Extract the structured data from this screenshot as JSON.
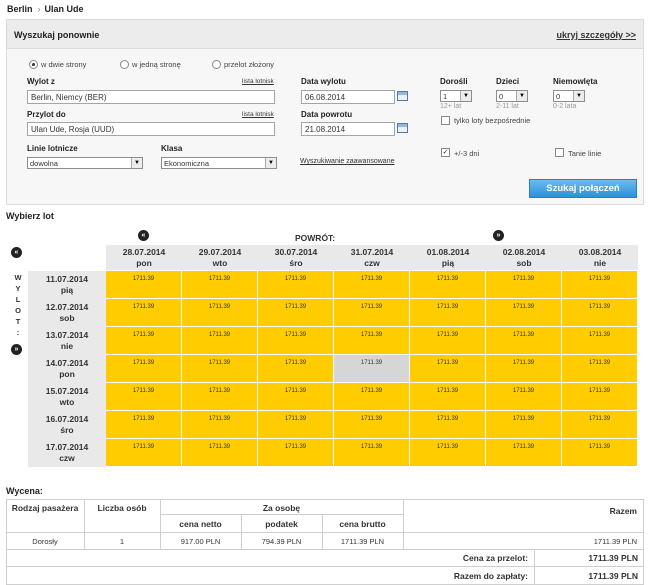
{
  "route": {
    "from": "Berlin",
    "separator": "›",
    "to": "Ulan Ude"
  },
  "search": {
    "title": "Wyszukaj ponownie",
    "hide_details": "ukryj szczegóły >>",
    "trip_types": [
      "w dwie strony",
      "w jedną stronę",
      "przelot złożony"
    ],
    "selected_trip_type": "w dwie strony",
    "from_label": "Wylot z",
    "from_value": "Berlin, Niemcy (BER)",
    "to_label": "Przylot do",
    "to_value": "Ulan Ude, Rosja (UUD)",
    "airport_list_link": "lista lotnisk",
    "depart_label": "Data wylotu",
    "depart_value": "06.08.2014",
    "return_label": "Data powrotu",
    "return_value": "21.08.2014",
    "airline_label": "Linie lotnicze",
    "airline_value": "dowolna",
    "class_label": "Klasa",
    "class_value": "Ekonomiczna",
    "advanced_link": "Wyszukiwanie zaawansowane",
    "adults_label": "Dorośli",
    "adults_value": "1",
    "adults_hint": "12+ lat",
    "children_label": "Dzieci",
    "children_value": "0",
    "children_hint": "2-11 lat",
    "infants_label": "Niemowlęta",
    "infants_value": "0",
    "infants_hint": "0-2 lata",
    "direct_only_label": "tylko loty bezpośrednie",
    "plusminus_label": "+/-3 dni",
    "cheap_lines_label": "Tanie linie",
    "search_button": "Szukaj połączeń"
  },
  "grid": {
    "title": "Wybierz lot",
    "return_label": "POWRÓT:",
    "prev_icon": "double-left-chevron",
    "next_icon": "double-right-chevron",
    "up_icon": "double-up-chevron",
    "down_icon": "double-down-chevron",
    "depart_vertical_label": "WYLOT:",
    "columns": [
      {
        "date": "28.07.2014",
        "day": "pon"
      },
      {
        "date": "29.07.2014",
        "day": "wto"
      },
      {
        "date": "30.07.2014",
        "day": "śro"
      },
      {
        "date": "31.07.2014",
        "day": "czw"
      },
      {
        "date": "01.08.2014",
        "day": "pią"
      },
      {
        "date": "02.08.2014",
        "day": "sob"
      },
      {
        "date": "03.08.2014",
        "day": "nie"
      }
    ],
    "rows": [
      {
        "date": "11.07.2014",
        "day": "pią",
        "prices": [
          "1711.39",
          "1711.39",
          "1711.39",
          "1711.39",
          "1711.39",
          "1711.39",
          "1711.39"
        ]
      },
      {
        "date": "12.07.2014",
        "day": "sob",
        "prices": [
          "1711.39",
          "1711.39",
          "1711.39",
          "1711.39",
          "1711.39",
          "1711.39",
          "1711.39"
        ]
      },
      {
        "date": "13.07.2014",
        "day": "nie",
        "prices": [
          "1711.39",
          "1711.39",
          "1711.39",
          "1711.39",
          "1711.39",
          "1711.39",
          "1711.39"
        ]
      },
      {
        "date": "14.07.2014",
        "day": "pon",
        "prices": [
          "1711.39",
          "1711.39",
          "1711.39",
          "1711.39",
          "1711.39",
          "1711.39",
          "1711.39"
        ]
      },
      {
        "date": "15.07.2014",
        "day": "wto",
        "prices": [
          "1711.39",
          "1711.39",
          "1711.39",
          "1711.39",
          "1711.39",
          "1711.39",
          "1711.39"
        ]
      },
      {
        "date": "16.07.2014",
        "day": "śro",
        "prices": [
          "1711.39",
          "1711.39",
          "1711.39",
          "1711.39",
          "1711.39",
          "1711.39",
          "1711.39"
        ]
      },
      {
        "date": "17.07.2014",
        "day": "czw",
        "prices": [
          "1711.39",
          "1711.39",
          "1711.39",
          "1711.39",
          "1711.39",
          "1711.39",
          "1711.39"
        ]
      }
    ],
    "selected": {
      "row": 3,
      "col": 3
    },
    "colors": {
      "cell": "#ffcc00",
      "selected": "#d6d6d6",
      "header": "#e9e9e9"
    }
  },
  "pricing": {
    "title": "Wycena:",
    "passenger_type_header": "Rodzaj pasażera",
    "count_header": "Liczba osób",
    "per_person_header": "Za osobę",
    "net_header": "cena netto",
    "tax_header": "podatek",
    "gross_header": "cena brutto",
    "total_header": "Razem",
    "row": {
      "type": "Dorosły",
      "count": "1",
      "net": "917.00 PLN",
      "tax": "794.39 PLN",
      "gross": "1711.39 PLN",
      "total": "1711.39 PLN"
    },
    "flight_price_label": "Cena za przelot:",
    "flight_price_value": "1711.39 PLN",
    "to_pay_label": "Razem do zapłaty:",
    "to_pay_value": "1711.39 PLN"
  }
}
